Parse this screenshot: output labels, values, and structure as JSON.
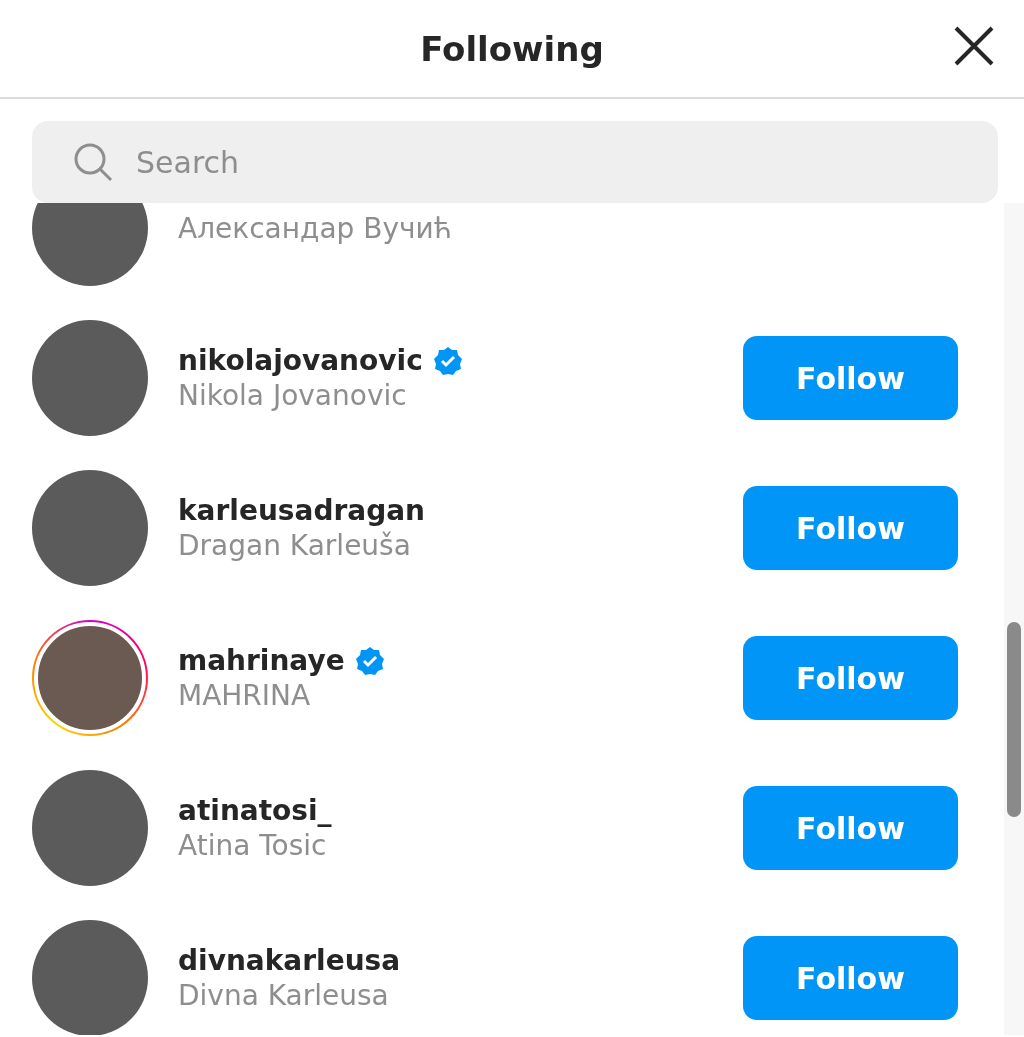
{
  "header": {
    "title": "Following"
  },
  "search": {
    "placeholder": "Search"
  },
  "rows": [
    {
      "name": "Александар Вучић",
      "story_ring": false
    },
    {
      "username": "nikolajovanovic",
      "name": "Nikola Jovanovic",
      "verified": true,
      "story_ring": false,
      "button": "Follow"
    },
    {
      "username": "karleusadragan",
      "name": "Dragan Karleuša",
      "verified": false,
      "story_ring": false,
      "button": "Follow"
    },
    {
      "username": "mahrinaye",
      "name": "MAHRINA",
      "verified": true,
      "story_ring": true,
      "button": "Follow"
    },
    {
      "username": "atinatosi_",
      "name": "Atina Tosic",
      "verified": false,
      "story_ring": false,
      "button": "Follow"
    },
    {
      "username": "divnakarleusa",
      "name": "Divna Karleusa",
      "verified": false,
      "story_ring": false,
      "button": "Follow"
    }
  ]
}
